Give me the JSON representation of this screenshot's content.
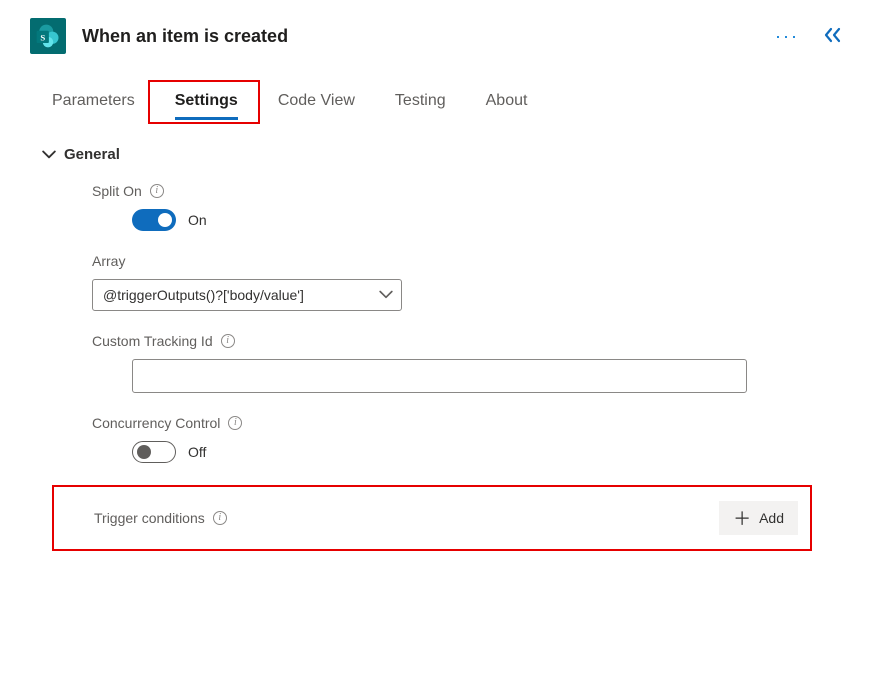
{
  "header": {
    "title": "When an item is created",
    "icon_name": "sharepoint-icon"
  },
  "tabs": [
    {
      "label": "Parameters",
      "active": false
    },
    {
      "label": "Settings",
      "active": true
    },
    {
      "label": "Code View",
      "active": false
    },
    {
      "label": "Testing",
      "active": false
    },
    {
      "label": "About",
      "active": false
    }
  ],
  "section": {
    "title": "General"
  },
  "settings": {
    "split_on": {
      "label": "Split On",
      "state_label": "On",
      "enabled": true
    },
    "array": {
      "label": "Array",
      "value": "@triggerOutputs()?['body/value']"
    },
    "custom_tracking_id": {
      "label": "Custom Tracking Id",
      "value": ""
    },
    "concurrency": {
      "label": "Concurrency Control",
      "state_label": "Off",
      "enabled": false
    },
    "trigger_conditions": {
      "label": "Trigger conditions",
      "add_label": "Add"
    }
  }
}
